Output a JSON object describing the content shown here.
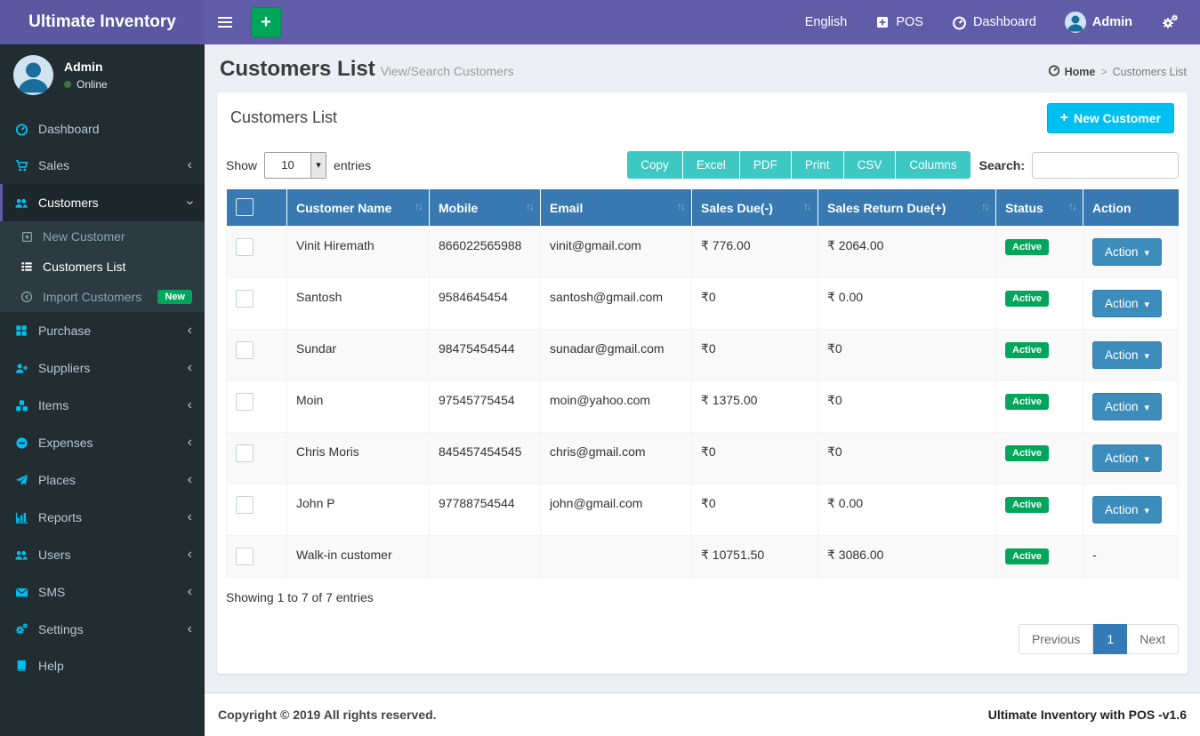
{
  "app": {
    "title": "Ultimate Inventory",
    "copyright": "Copyright © 2019 All rights reserved.",
    "version_label": "Ultimate Inventory with POS -v1.6"
  },
  "navbar": {
    "language": "English",
    "pos": "POS",
    "dashboard": "Dashboard",
    "user": "Admin"
  },
  "user_panel": {
    "name": "Admin",
    "status": "Online"
  },
  "sidebar": {
    "items": [
      {
        "label": "Dashboard"
      },
      {
        "label": "Sales"
      },
      {
        "label": "Customers"
      },
      {
        "label": "Purchase"
      },
      {
        "label": "Suppliers"
      },
      {
        "label": "Items"
      },
      {
        "label": "Expenses"
      },
      {
        "label": "Places"
      },
      {
        "label": "Reports"
      },
      {
        "label": "Users"
      },
      {
        "label": "SMS"
      },
      {
        "label": "Settings"
      },
      {
        "label": "Help"
      }
    ],
    "customers_children": [
      {
        "label": "New Customer"
      },
      {
        "label": "Customers List"
      },
      {
        "label": "Import Customers",
        "badge": "New"
      }
    ]
  },
  "page": {
    "title": "Customers List",
    "subtitle": "View/Search Customers",
    "breadcrumb_home": "Home",
    "breadcrumb_current": "Customers List"
  },
  "panel": {
    "title": "Customers List",
    "new_button": "New Customer"
  },
  "controls": {
    "show_label": "Show",
    "entries_label": "entries",
    "page_length": "10",
    "buttons": [
      "Copy",
      "Excel",
      "PDF",
      "Print",
      "CSV",
      "Columns"
    ],
    "search_label": "Search:",
    "search_value": ""
  },
  "table": {
    "columns": [
      "Customer Name",
      "Mobile",
      "Email",
      "Sales Due(-)",
      "Sales Return Due(+)",
      "Status",
      "Action"
    ],
    "rows": [
      {
        "name": "Vinit Hiremath",
        "mobile": "866022565988",
        "email": "vinit@gmail.com",
        "sales_due": "₹ 776.00",
        "sales_return_due": "₹ 2064.00",
        "status": "Active",
        "action": "Action"
      },
      {
        "name": "Santosh",
        "mobile": "9584645454",
        "email": "santosh@gmail.com",
        "sales_due": "₹0",
        "sales_return_due": "₹ 0.00",
        "status": "Active",
        "action": "Action"
      },
      {
        "name": "Sundar",
        "mobile": "98475454544",
        "email": "sunadar@gmail.com",
        "sales_due": "₹0",
        "sales_return_due": "₹0",
        "status": "Active",
        "action": "Action"
      },
      {
        "name": "Moin",
        "mobile": "97545775454",
        "email": "moin@yahoo.com",
        "sales_due": "₹ 1375.00",
        "sales_return_due": "₹0",
        "status": "Active",
        "action": "Action"
      },
      {
        "name": "Chris Moris",
        "mobile": "845457454545",
        "email": "chris@gmail.com",
        "sales_due": "₹0",
        "sales_return_due": "₹0",
        "status": "Active",
        "action": "Action"
      },
      {
        "name": "John P",
        "mobile": "97788754544",
        "email": "john@gmail.com",
        "sales_due": "₹0",
        "sales_return_due": "₹ 0.00",
        "status": "Active",
        "action": "Action"
      },
      {
        "name": "Walk-in customer",
        "mobile": "",
        "email": "",
        "sales_due": "₹ 10751.50",
        "sales_return_due": "₹ 3086.00",
        "status": "Active",
        "action": "-"
      }
    ],
    "info": "Showing 1 to 7 of 7 entries"
  },
  "pagination": {
    "previous": "Previous",
    "page": "1",
    "next": "Next"
  },
  "colors": {
    "navbar_purple": "#605ca8",
    "sidebar_dark": "#222d32",
    "sidebar_icon_blue": "#00c0ef",
    "table_header_blue": "#3779b0",
    "action_blue": "#3c8dbc",
    "export_teal": "#3dc8c3",
    "new_button_cyan": "#00c0ef",
    "success_green": "#00a65a",
    "page_bg": "#ecf0f5",
    "pagination_active": "#337ab7"
  }
}
